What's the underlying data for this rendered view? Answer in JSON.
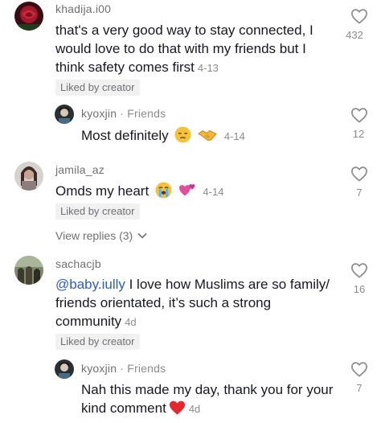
{
  "comments": [
    {
      "username": "khadija.i00",
      "lines": [
        "that's a very good way to stay connected, I",
        "would love to do that with my friends but I",
        "think safety comes first"
      ],
      "date": "4-13",
      "badge": "Liked by creator",
      "likes": "432"
    },
    {
      "username": "kyoxjin",
      "tag_sep": " · ",
      "tag": "Friends",
      "text": "Most definitely",
      "emojis": [
        "pensive-face",
        "handshake"
      ],
      "date": "4-14",
      "likes": "12"
    },
    {
      "username": "jamila_az",
      "text": "Omds my heart",
      "emojis": [
        "loudly-crying-face",
        "revolving-hearts"
      ],
      "date": "4-14",
      "badge": "Liked by creator",
      "likes": "7",
      "view_replies": "View replies (3)"
    },
    {
      "username": "sachacjb",
      "mention": "@baby.iully",
      "line1_rest": " I love how Muslims are so family/",
      "line2": "friends orientated, it’s such a strong",
      "line3": "community",
      "date": "4d",
      "badge": "Liked by creator",
      "likes": "16"
    },
    {
      "username": "kyoxjin",
      "tag_sep": " · ",
      "tag": "Friends",
      "line1": "Nah this made my day, thank you for your",
      "line2": "kind comment",
      "emojis": [
        "red-heart"
      ],
      "date": "4d",
      "likes": "7"
    }
  ],
  "colors": {
    "text": "#161823",
    "secondary": "#8a8b91",
    "mention": "#2b5db9",
    "badge_bg": "#f1f1f2"
  }
}
